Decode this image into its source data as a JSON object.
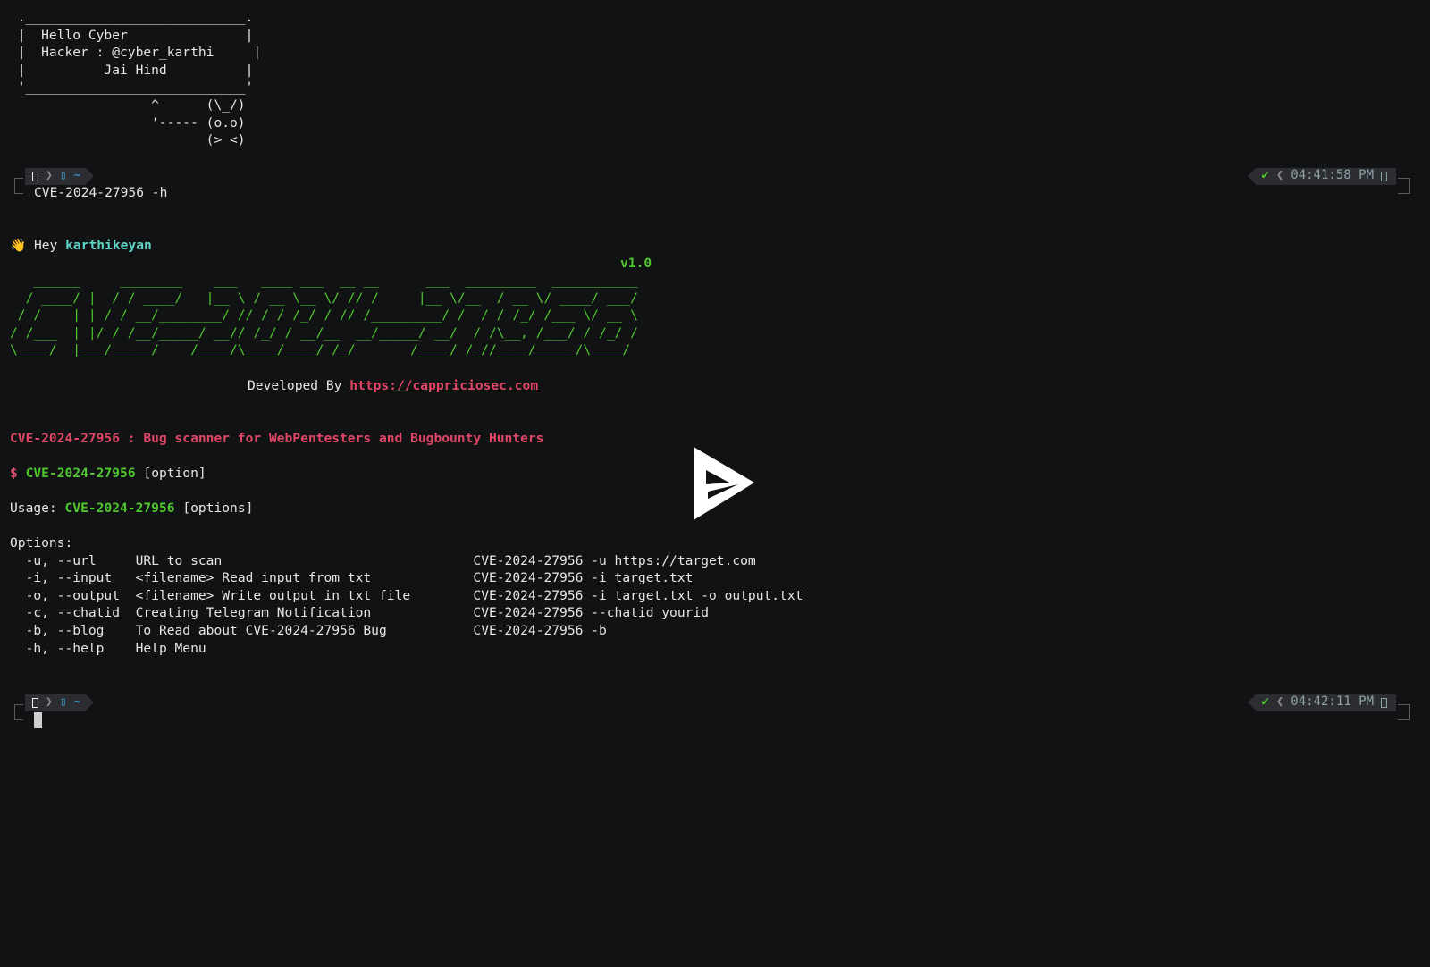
{
  "banner": {
    "box_top": " .____________________________.",
    "line1": " |  Hello Cyber               |",
    "line2": " |  Hacker : @cyber_karthi     |",
    "line3": " |          Jai Hind          |",
    "box_bottom": " '____________________________'",
    "owl1": "                  ^      (\\_/)",
    "owl2": "                  '----- (o.o)",
    "owl3": "                         (> <)"
  },
  "prompt1": {
    "left_icons": [
      "os-icon",
      "folder-icon"
    ],
    "dir": "~",
    "command": "CVE-2024-27956 -h",
    "status": "✔",
    "time": "04:41:58 PM"
  },
  "greeting": {
    "wave": "👋",
    "hey": "Hey",
    "user": "karthikeyan"
  },
  "version": "v1.0",
  "ascii_art": [
    "   ______     ________    ___   ____ ___  __ __      ___  _________  ___________",
    "  / ____/ |  / / ____/   |__ \\ / __ \\__ \\/ // /     |__ \\/__  / __ \\/ ____/ ___/",
    " / /    | | / / __/________/ // / / /_/ / // /_________/ /  / / /_/ /___ \\/ __ \\",
    "/ /___  | |/ / /__/_____/ __// /_/ / __/__  __/_____/ __/  / /\\__, /___/ / /_/ /",
    "\\____/  |___/_____/    /____/\\____/____/ /_/       /____/ /_//____/_____/\\____/"
  ],
  "developed_by": {
    "label": "Developed By",
    "url": "https://cappriciosec.com"
  },
  "description": "CVE-2024-27956 : Bug scanner for WebPentesters and Bugbounty Hunters",
  "syntax": {
    "dollar": "$",
    "tool": "CVE-2024-27956",
    "arg": "[option]"
  },
  "usage": {
    "label": "Usage:",
    "tool": "CVE-2024-27956",
    "arg": "[options]"
  },
  "options_title": "Options:",
  "options": [
    {
      "flag": "  -u, --url     ",
      "desc": "URL to scan                                ",
      "example": "CVE-2024-27956 -u https://target.com"
    },
    {
      "flag": "  -i, --input   ",
      "desc": "<filename> Read input from txt             ",
      "example": "CVE-2024-27956 -i target.txt"
    },
    {
      "flag": "  -o, --output  ",
      "desc": "<filename> Write output in txt file        ",
      "example": "CVE-2024-27956 -i target.txt -o output.txt"
    },
    {
      "flag": "  -c, --chatid  ",
      "desc": "Creating Telegram Notification             ",
      "example": "CVE-2024-27956 --chatid yourid"
    },
    {
      "flag": "  -b, --blog    ",
      "desc": "To Read about CVE-2024-27956 Bug           ",
      "example": "CVE-2024-27956 -b"
    },
    {
      "flag": "  -h, --help    ",
      "desc": "Help Menu",
      "example": ""
    }
  ],
  "prompt2": {
    "left_icons": [
      "os-icon",
      "folder-icon"
    ],
    "dir": "~",
    "status": "✔",
    "time": "04:42:11 PM"
  },
  "player": {
    "icon": "play-icon"
  },
  "colors": {
    "background": "#111214",
    "green": "#4ec72e",
    "teal": "#5fd7c7",
    "red": "#e04666",
    "segment": "#2b2d30"
  }
}
